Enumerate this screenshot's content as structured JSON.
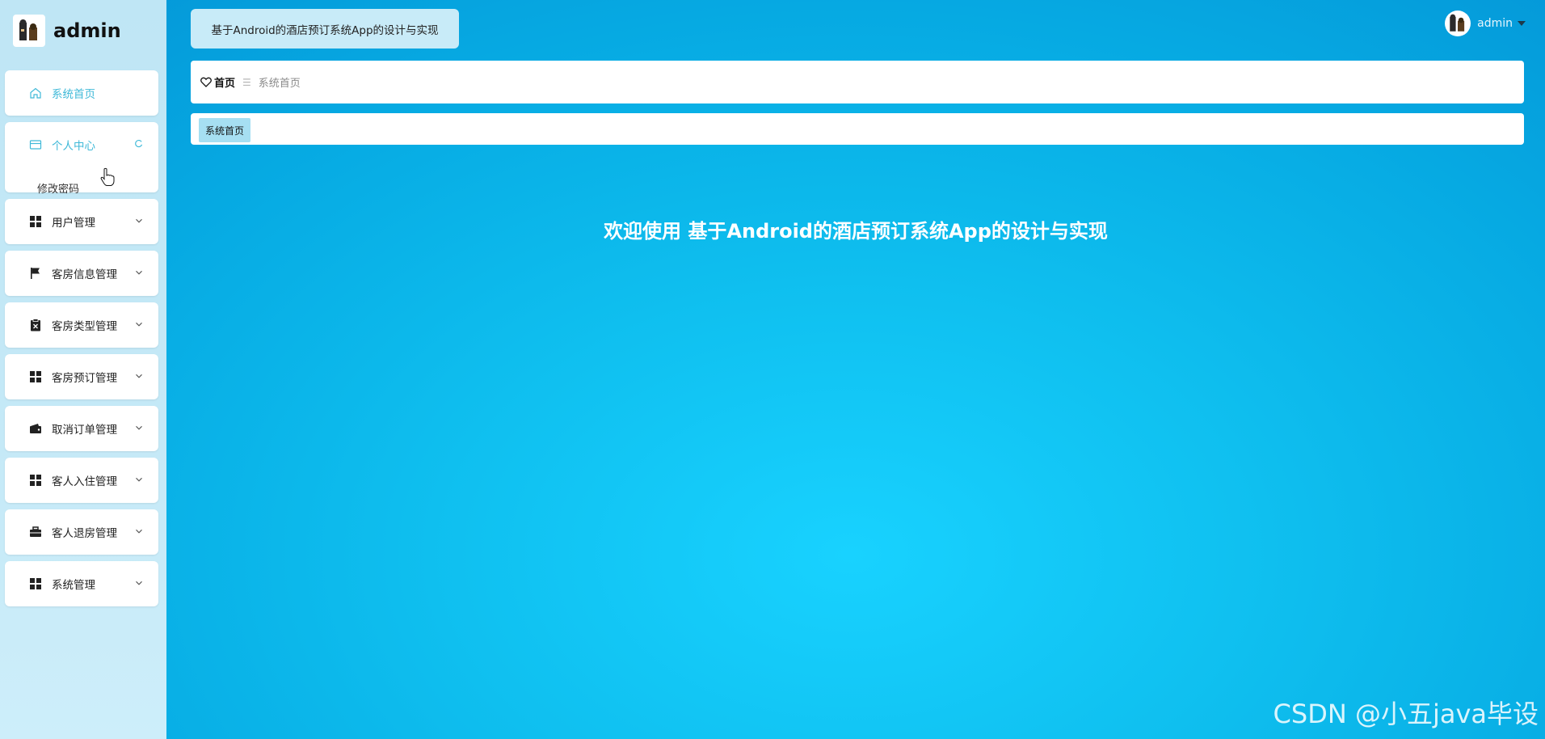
{
  "sidebar": {
    "logo_title": "admin",
    "items": [
      {
        "label": "系统首页",
        "icon": "home-icon",
        "active": true
      },
      {
        "label": "个人中心",
        "icon": "card-icon",
        "active": true,
        "expanded": true,
        "children": [
          {
            "label": "修改密码"
          }
        ]
      },
      {
        "label": "用户管理",
        "icon": "grid-icon"
      },
      {
        "label": "客房信息管理",
        "icon": "flag-icon"
      },
      {
        "label": "客房类型管理",
        "icon": "clipboard-x-icon"
      },
      {
        "label": "客房预订管理",
        "icon": "grid-icon"
      },
      {
        "label": "取消订单管理",
        "icon": "wallet-icon"
      },
      {
        "label": "客人入住管理",
        "icon": "grid-icon"
      },
      {
        "label": "客人退房管理",
        "icon": "briefcase-icon"
      },
      {
        "label": "系统管理",
        "icon": "grid-icon"
      }
    ]
  },
  "header": {
    "system_title": "基于Android的酒店预订系统App的设计与实现",
    "username": "admin"
  },
  "breadcrumb": {
    "home_label": "首页",
    "current": "系统首页"
  },
  "tabs": [
    {
      "label": "系统首页",
      "active": true
    }
  ],
  "main": {
    "welcome_text": "欢迎使用 基于Android的酒店预订系统App的设计与实现"
  },
  "watermark": "CSDN @小五java毕设",
  "colors": {
    "accent": "#3fb9d8",
    "tab_active_bg": "#a6dff2",
    "title_box_bg": "#c8ebf8"
  }
}
